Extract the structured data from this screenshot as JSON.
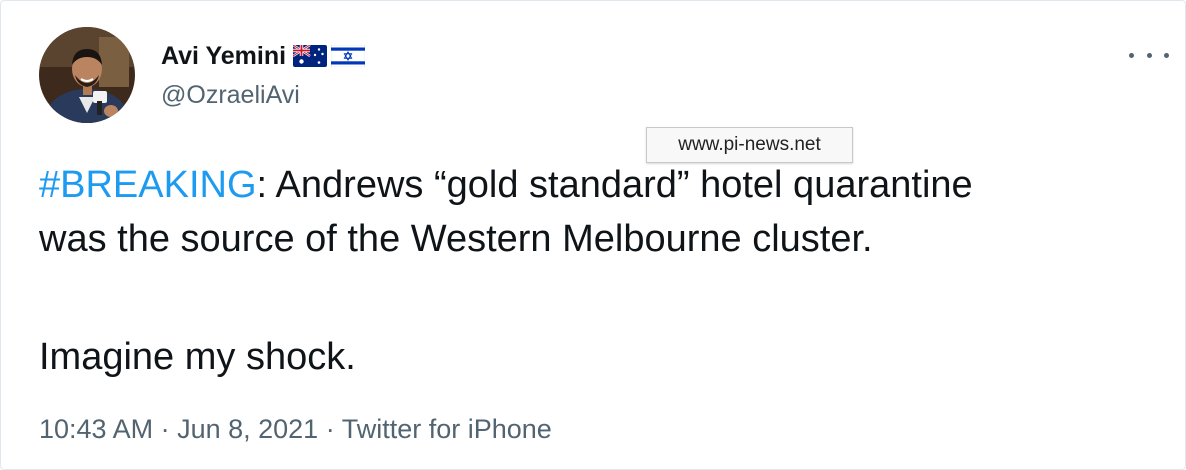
{
  "author": {
    "display_name": "Avi Yemini",
    "handle": "@OzraeliAvi",
    "flags": [
      "australia-flag-icon",
      "israel-flag-icon"
    ]
  },
  "tooltip": {
    "text": "www.pi-news.net"
  },
  "tweet": {
    "hashtag": "#BREAKING",
    "line1_rest": ": Andrews “gold standard” hotel quarantine",
    "line2": "was the source of the Western Melbourne cluster.",
    "line3": "Imagine my shock."
  },
  "meta": {
    "time": "10:43 AM",
    "separator": " · ",
    "date": "Jun 8, 2021",
    "source": "Twitter for iPhone"
  },
  "colors": {
    "link": "#1d9bf0",
    "secondary_text": "#536471",
    "primary_text": "#0f1419"
  }
}
